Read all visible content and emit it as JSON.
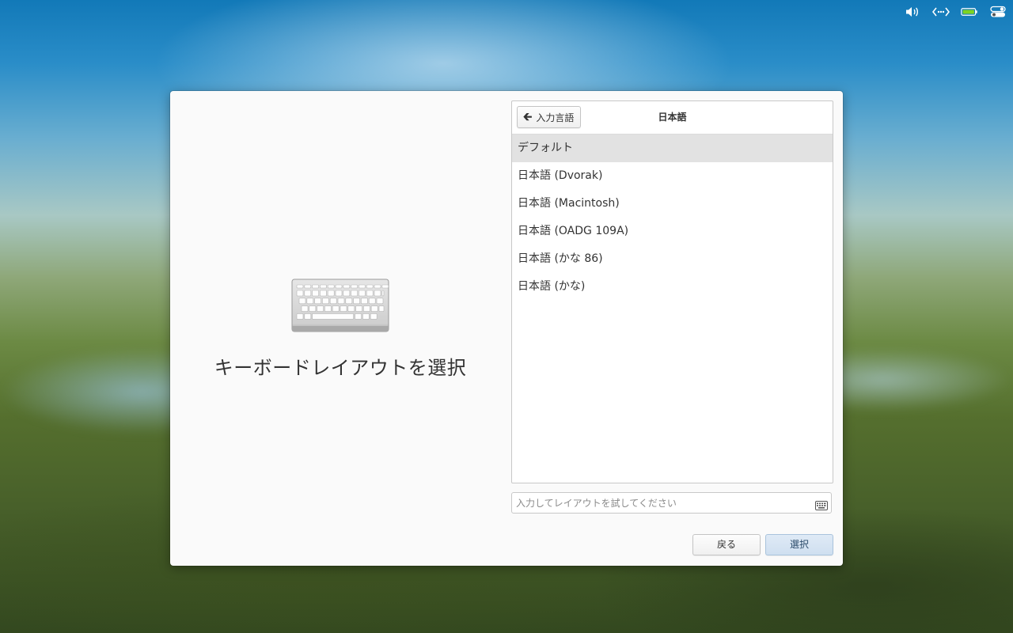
{
  "panel": {
    "icons": [
      "volume-icon",
      "network-icon",
      "battery-icon",
      "settings-toggle-icon"
    ]
  },
  "installer": {
    "left": {
      "title": "キーボードレイアウトを選択",
      "illustration": "keyboard-illustration-icon"
    },
    "layout_list": {
      "back_label": "入力言語",
      "header_title": "日本語",
      "items": [
        {
          "label": "デフォルト",
          "selected": true
        },
        {
          "label": "日本語 (Dvorak)",
          "selected": false
        },
        {
          "label": "日本語 (Macintosh)",
          "selected": false
        },
        {
          "label": "日本語 (OADG 109A)",
          "selected": false
        },
        {
          "label": "日本語 (かな 86)",
          "selected": false
        },
        {
          "label": "日本語 (かな)",
          "selected": false
        }
      ]
    },
    "test_entry": {
      "placeholder": "入力してレイアウトを試してください",
      "value": ""
    },
    "buttons": {
      "back_label": "戻る",
      "select_label": "選択"
    }
  }
}
